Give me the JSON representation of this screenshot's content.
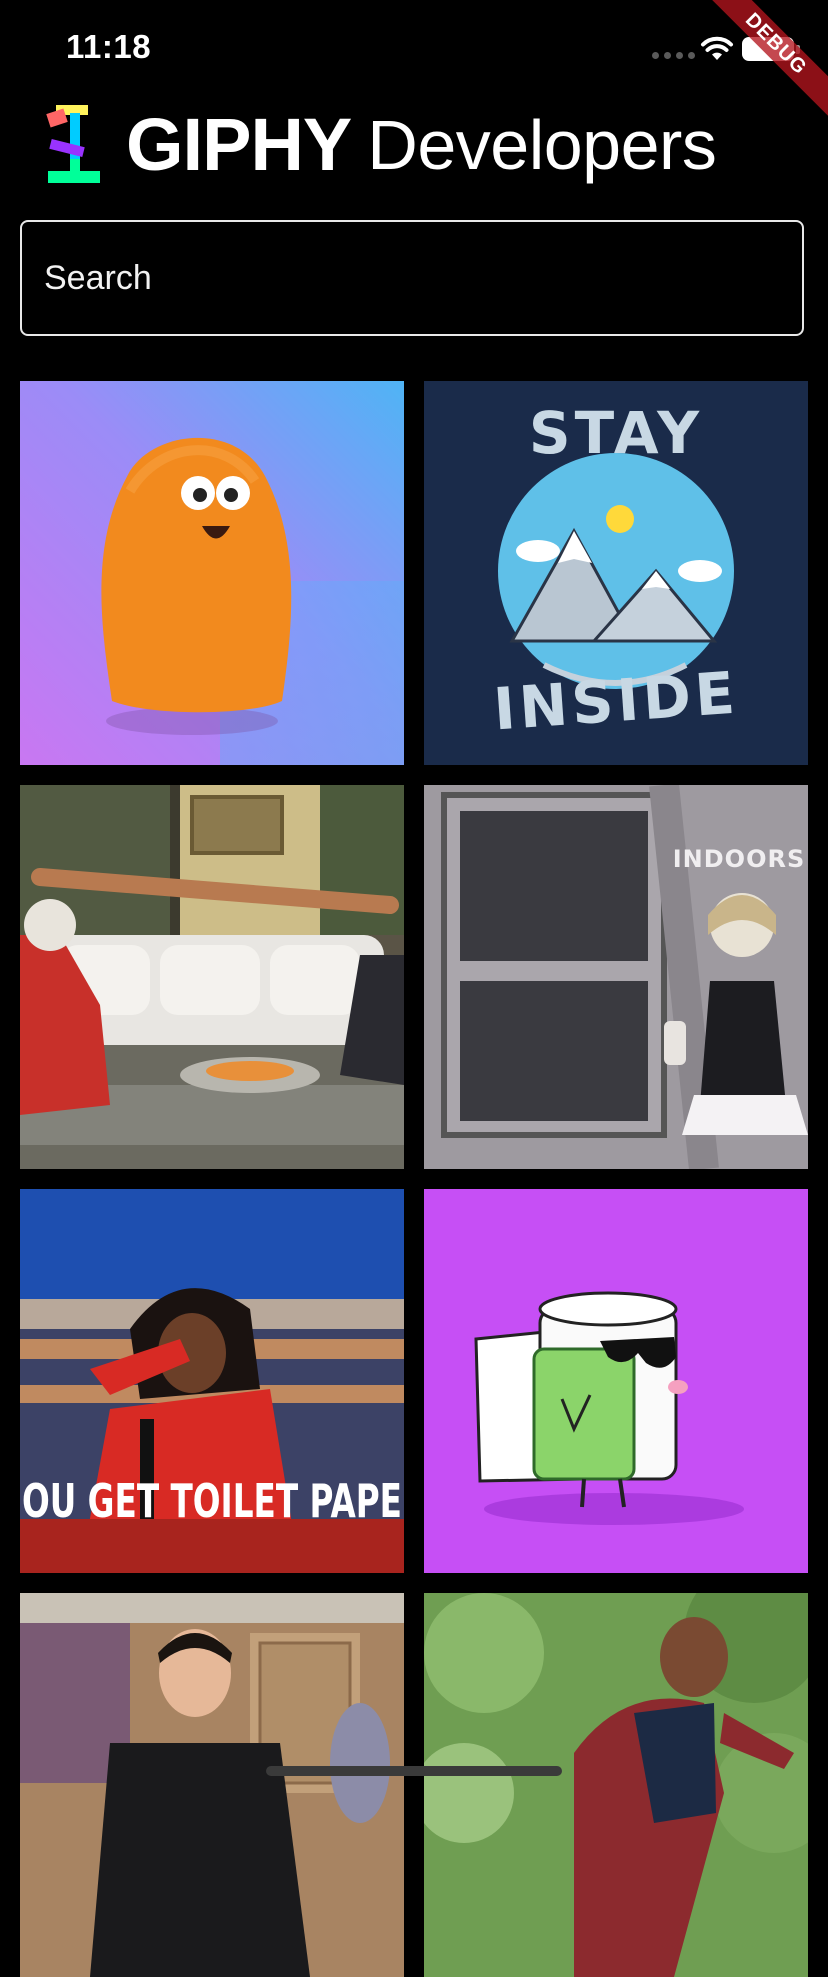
{
  "status_bar": {
    "time": "11:18",
    "debug_banner": "DEBUG"
  },
  "header": {
    "brand": "GIPHY",
    "subtitle": "Developers"
  },
  "search": {
    "placeholder": "Search",
    "value": ""
  },
  "gifs": [
    {
      "name": "orange-blob-character"
    },
    {
      "name": "stay-inside-mountains",
      "text_top": "STAY",
      "text_bottom": "INSIDE"
    },
    {
      "name": "couch-stretch-scene"
    },
    {
      "name": "indoors-retro-woman",
      "text": "INDOORS"
    },
    {
      "name": "oprah-toilet-paper",
      "text": "OU GET TOILET PAPE"
    },
    {
      "name": "toilet-paper-sunglasses"
    },
    {
      "name": "man-in-clothing-store"
    },
    {
      "name": "man-dancing-outdoors"
    }
  ]
}
